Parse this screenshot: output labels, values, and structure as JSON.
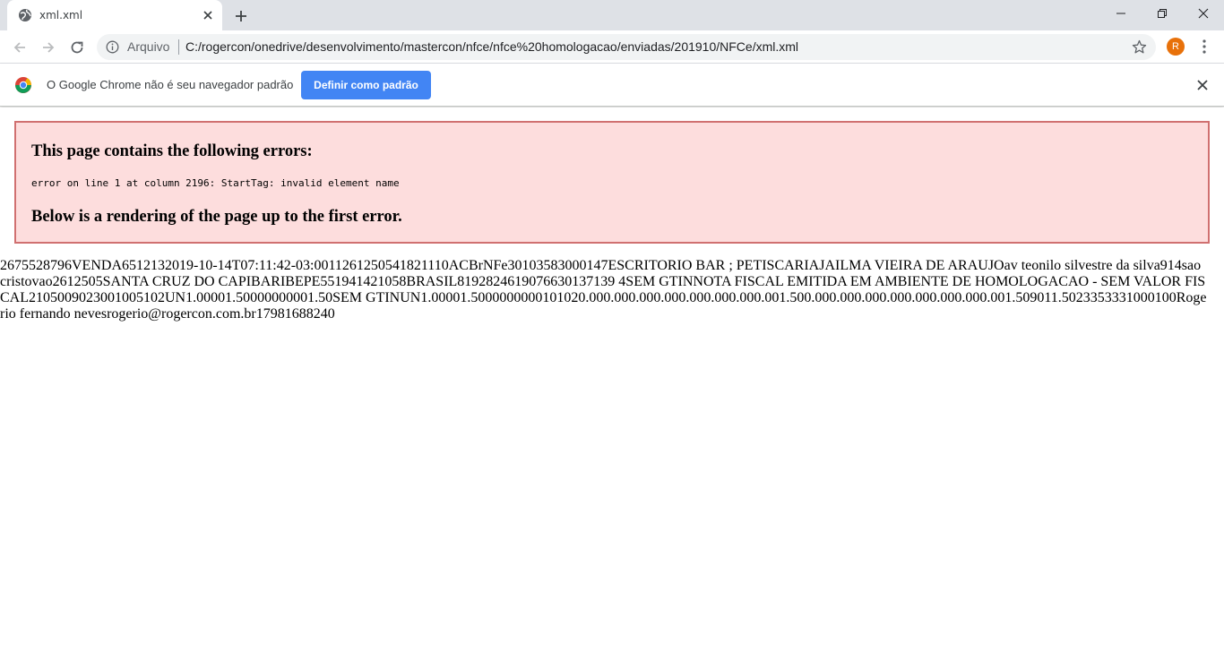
{
  "tab": {
    "title": "xml.xml"
  },
  "omnibox": {
    "scheme": "Arquivo",
    "url": "C:/rogercon/onedrive/desenvolvimento/mastercon/nfce/nfce%20homologacao/enviadas/201910/NFCe/xml.xml"
  },
  "profile": {
    "initial": "R",
    "color": "#e8710a"
  },
  "infobar": {
    "message": "O Google Chrome não é seu navegador padrão",
    "button": "Definir como padrão"
  },
  "page": {
    "error_heading": "This page contains the following errors:",
    "error_detail": "error on line 1 at column 2196: StartTag: invalid element name",
    "render_heading": "Below is a rendering of the page up to the first error.",
    "xml_text": "2675528796VENDA6512132019-10-14T07:11:42-03:0011261250541821110ACBrNFe30103583000147ESCRITORIO BAR ; PETISCARIAJAILMA VIEIRA DE ARAUJOav teonilo silvestre da silva914sao cristovao2612505SANTA CRUZ DO CAPIBARIBEPE551941421058BRASIL8192824619076630137139 4SEM GTINNOTA FISCAL EMITIDA EM AMBIENTE DE HOMOLOGACAO - SEM VALOR FISCAL2105009023001005102UN1.00001.50000000001.50SEM GTINUN1.00001.5000000000101020.000.000.000.000.000.000.000.001.500.000.000.000.000.000.000.000.001.509011.5023353331000100Rogerio fernando nevesrogerio@rogercon.com.br17981688240"
  },
  "colors": {
    "error_bg": "#fddddd",
    "error_border": "#d07070",
    "accent_button": "#4285f4"
  }
}
